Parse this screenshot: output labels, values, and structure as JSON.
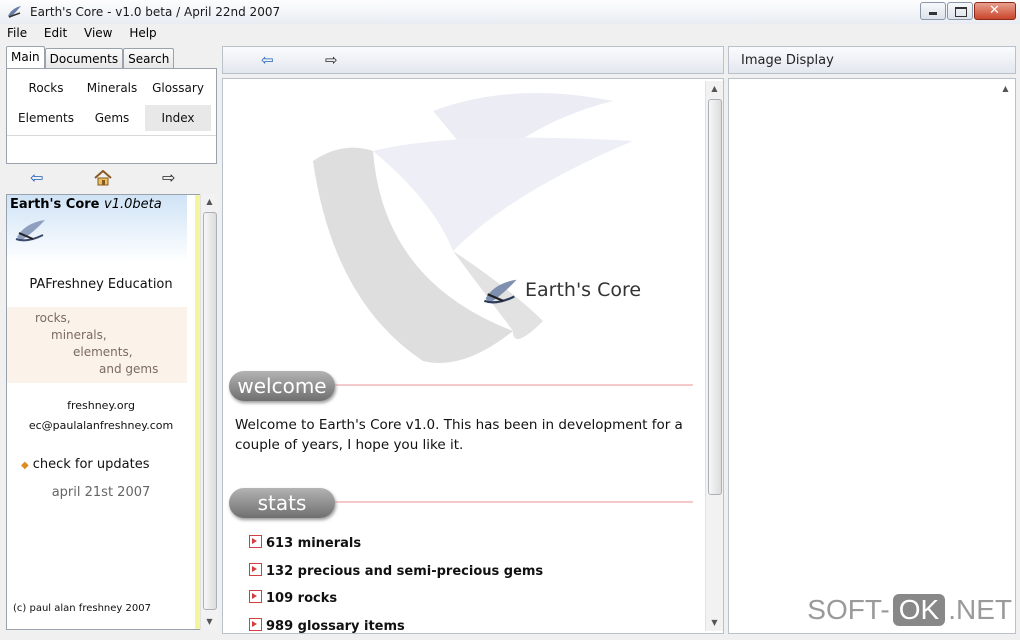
{
  "window": {
    "title": "Earth's Core - v1.0 beta / April 22nd 2007"
  },
  "menu": [
    "File",
    "Edit",
    "View",
    "Help"
  ],
  "left": {
    "tabs": [
      "Main",
      "Documents",
      "Search"
    ],
    "grid": [
      "Rocks",
      "Minerals",
      "Glossary",
      "Elements",
      "Gems",
      "Index"
    ],
    "info": {
      "brand": "Earth's Core",
      "version": "v1.0beta",
      "publisher": "PAFreshney Education",
      "topics": [
        "rocks,",
        "minerals,",
        "elements,",
        "and gems"
      ],
      "website": "freshney.org",
      "email": "ec@paulalanfreshney.com",
      "updates_link": "check for updates",
      "date": "april 21st 2007",
      "copyright": "(c) paul alan freshney 2007"
    }
  },
  "center": {
    "brand": "Earth's Core",
    "welcome_heading": "welcome",
    "welcome_text": "Welcome to Earth's Core v1.0. This has been in development for a couple of years, I hope you like it.",
    "stats_heading": "stats",
    "stats": [
      "613 minerals",
      "132 precious and semi-precious gems",
      "109 rocks",
      "989 glossary items"
    ]
  },
  "right": {
    "title": "Image Display"
  },
  "watermark": {
    "left": "SOFT-",
    "mid": "OK",
    "right": ".NET"
  }
}
